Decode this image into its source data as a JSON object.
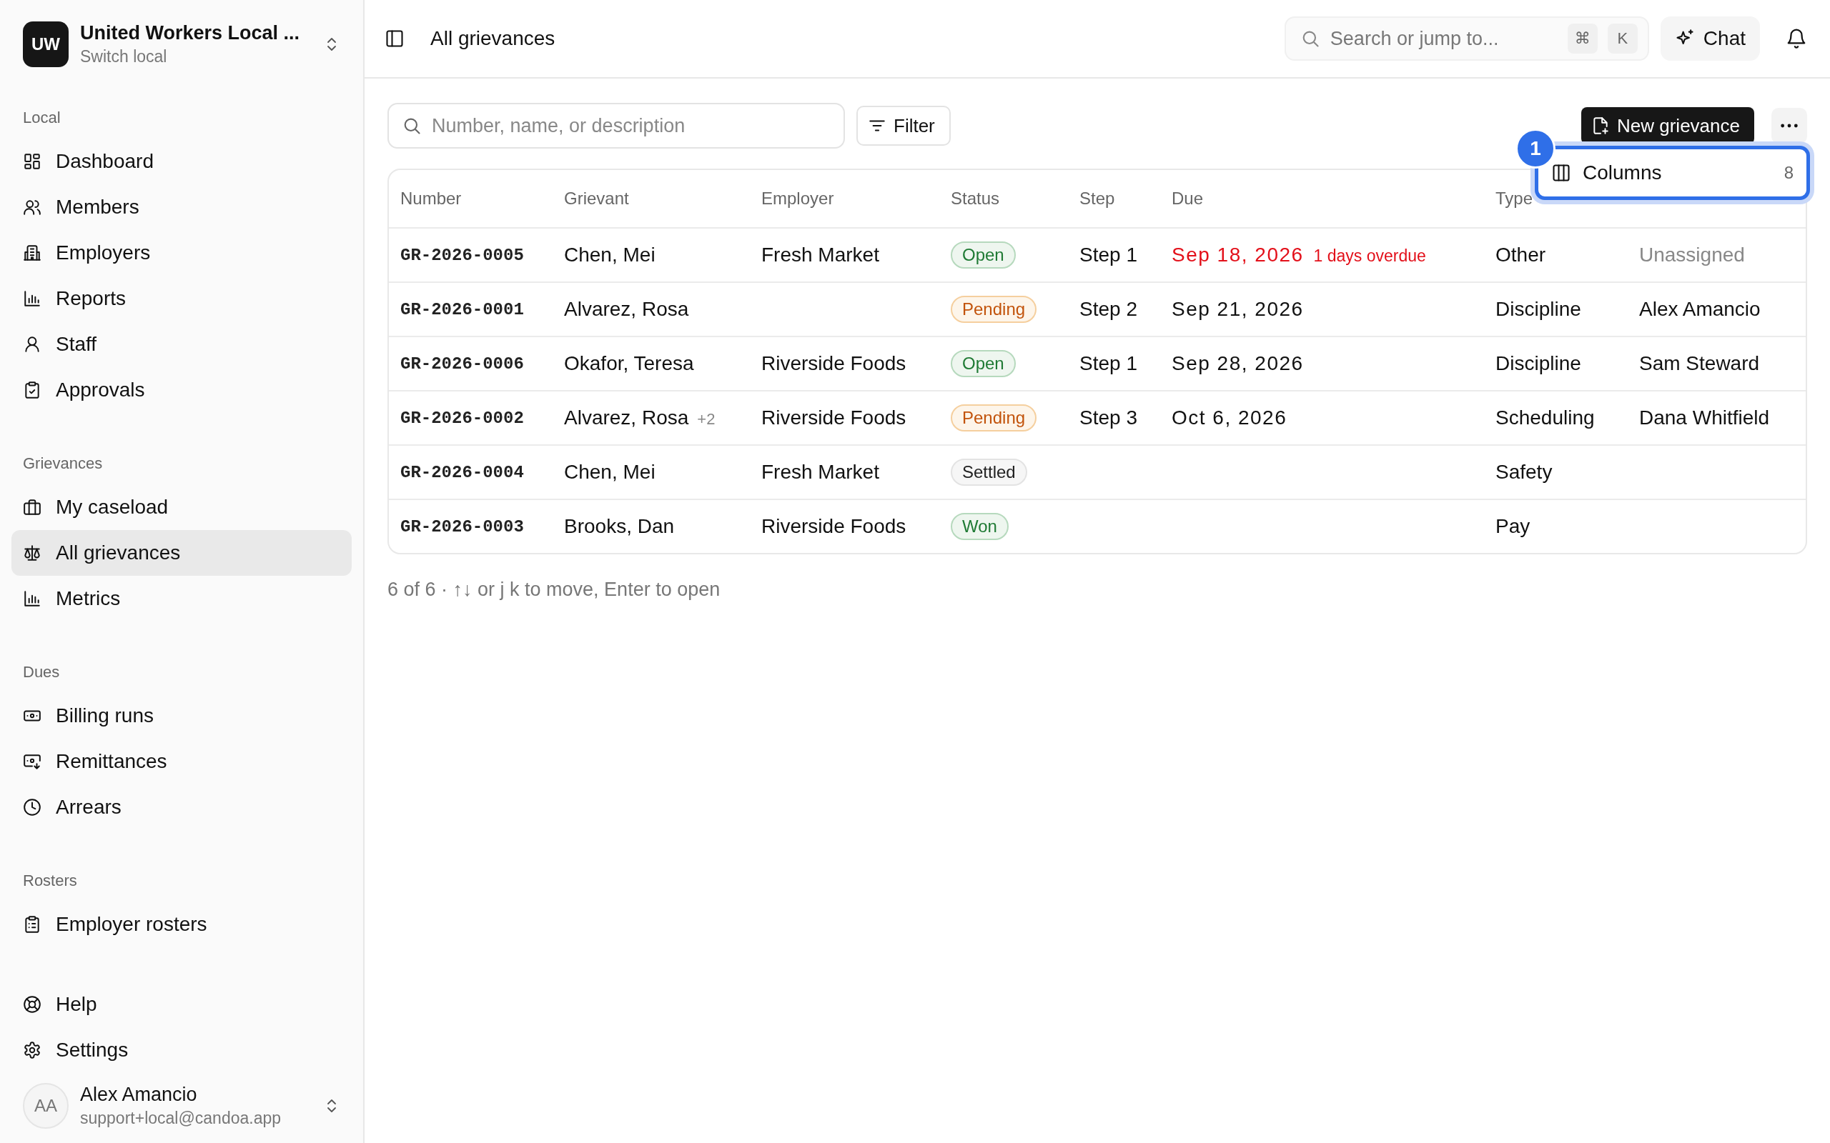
{
  "org": {
    "initials": "UW",
    "name": "United Workers Local ...",
    "subtitle": "Switch local"
  },
  "sidebar": {
    "sections": [
      {
        "heading": "Local",
        "items": [
          {
            "label": "Dashboard",
            "selected": false
          },
          {
            "label": "Members",
            "selected": false
          },
          {
            "label": "Employers",
            "selected": false
          },
          {
            "label": "Reports",
            "selected": false
          },
          {
            "label": "Staff",
            "selected": false
          },
          {
            "label": "Approvals",
            "selected": false
          }
        ]
      },
      {
        "heading": "Grievances",
        "items": [
          {
            "label": "My caseload",
            "selected": false
          },
          {
            "label": "All grievances",
            "selected": true
          },
          {
            "label": "Metrics",
            "selected": false
          }
        ]
      },
      {
        "heading": "Dues",
        "items": [
          {
            "label": "Billing runs",
            "selected": false
          },
          {
            "label": "Remittances",
            "selected": false
          },
          {
            "label": "Arrears",
            "selected": false
          }
        ]
      },
      {
        "heading": "Rosters",
        "items": [
          {
            "label": "Employer rosters",
            "selected": false
          }
        ]
      },
      {
        "items": [
          {
            "label": "Help",
            "selected": false
          },
          {
            "label": "Settings",
            "selected": false
          }
        ]
      }
    ]
  },
  "user": {
    "initials": "AA",
    "name": "Alex Amancio",
    "email": "support+local@candoa.app"
  },
  "header": {
    "title": "All grievances",
    "search": {
      "placeholder": "Search or jump to..."
    },
    "shortcut_keys": [
      "⌘",
      "K"
    ],
    "chat_button": "Chat"
  },
  "toolbar": {
    "search": {
      "placeholder": "Number, name, or description"
    },
    "filter_button": "Filter",
    "new_button": "New grievance"
  },
  "columns_menu": {
    "badge": "1",
    "items": [
      {
        "label": "Columns",
        "count": "8",
        "highlighted": true
      }
    ]
  },
  "table": {
    "columns": [
      "Number",
      "Grievant",
      "Employer",
      "Status",
      "Step",
      "Due",
      "Type"
    ],
    "rows": [
      {
        "number": "GR-2026-0005",
        "grievant": "Chen, Mei",
        "employer": "Fresh Market",
        "status": {
          "label": "Open",
          "kind": "open"
        },
        "step": "Step 1",
        "due": "Sep 18, 2026",
        "overdue": true,
        "overdue_note": "1 days overdue",
        "type": "Other",
        "assignee": "Unassigned",
        "assignee_muted": true
      },
      {
        "number": "GR-2026-0001",
        "grievant": "Alvarez, Rosa",
        "status": {
          "label": "Pending",
          "kind": "pending"
        },
        "step": "Step 2",
        "due": "Sep 21, 2026",
        "overdue": false,
        "type": "Discipline",
        "assignee": "Alex Amancio",
        "assignee_muted": false
      },
      {
        "number": "GR-2026-0006",
        "grievant": "Okafor, Teresa",
        "employer": "Riverside Foods",
        "status": {
          "label": "Open",
          "kind": "open"
        },
        "step": "Step 1",
        "due": "Sep 28, 2026",
        "overdue": false,
        "type": "Discipline",
        "assignee": "Sam Steward",
        "assignee_muted": false
      },
      {
        "number": "GR-2026-0002",
        "grievant": "Alvarez, Rosa",
        "grievant_extra": "+2",
        "employer": "Riverside Foods",
        "status": {
          "label": "Pending",
          "kind": "pending"
        },
        "step": "Step 3",
        "due": "Oct 6, 2026",
        "overdue": false,
        "type": "Scheduling",
        "assignee": "Dana Whitfield",
        "assignee_muted": false
      },
      {
        "number": "GR-2026-0004",
        "grievant": "Chen, Mei",
        "employer": "Fresh Market",
        "status": {
          "label": "Settled",
          "kind": "settled"
        },
        "type": "Safety"
      },
      {
        "number": "GR-2026-0003",
        "grievant": "Brooks, Dan",
        "employer": "Riverside Foods",
        "status": {
          "label": "Won",
          "kind": "won"
        },
        "type": "Pay"
      }
    ]
  },
  "footer": "6 of 6 · ↑↓ or j k to move, Enter to open"
}
